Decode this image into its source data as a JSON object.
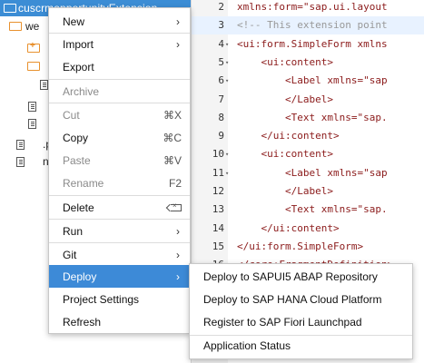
{
  "tree": {
    "project_label": "cuscrmopportunityExtension",
    "rows": [
      {
        "label": "we",
        "icon": "folder-icon"
      },
      {
        "label": "",
        "icon": "folder-plus-icon"
      },
      {
        "label": "",
        "icon": "folder-open-icon"
      },
      {
        "label": "",
        "icon": "file-icon"
      },
      {
        "label": "",
        "icon": "file-icon"
      },
      {
        "label": "",
        "icon": "file-icon"
      },
      {
        "label": ".p",
        "icon": "file-icon"
      },
      {
        "label": "ne",
        "icon": "file-icon"
      }
    ]
  },
  "editor": {
    "lines": [
      {
        "num": "2",
        "text": "xmlns:form=\"sap.ui.layout",
        "kind": "tag"
      },
      {
        "num": "3",
        "text": "<!-- This extension point",
        "kind": "comment"
      },
      {
        "num": "4",
        "text": "<ui:form.SimpleForm xmlns",
        "kind": "tag",
        "fold": true
      },
      {
        "num": "5",
        "text": "    <ui:content>",
        "kind": "tag",
        "fold": true
      },
      {
        "num": "6",
        "text": "        <Label xmlns=\"sap",
        "kind": "tag",
        "fold": true
      },
      {
        "num": "7",
        "text": "        </Label>",
        "kind": "tag"
      },
      {
        "num": "8",
        "text": "        <Text xmlns=\"sap.",
        "kind": "tag"
      },
      {
        "num": "9",
        "text": "    </ui:content>",
        "kind": "tag"
      },
      {
        "num": "10",
        "text": "    <ui:content>",
        "kind": "tag",
        "fold": true
      },
      {
        "num": "11",
        "text": "        <Label xmlns=\"sap",
        "kind": "tag",
        "fold": true
      },
      {
        "num": "12",
        "text": "        </Label>",
        "kind": "tag"
      },
      {
        "num": "13",
        "text": "        <Text xmlns=\"sap.",
        "kind": "tag"
      },
      {
        "num": "14",
        "text": "    </ui:content>",
        "kind": "tag"
      },
      {
        "num": "15",
        "text": "</ui:form.SimpleForm>",
        "kind": "tag"
      },
      {
        "num": "16",
        "text": "</core:FragmentDefinition>",
        "kind": "tag"
      }
    ]
  },
  "context_menu": {
    "items": {
      "new": {
        "label": "New",
        "arrow": "›"
      },
      "import": {
        "label": "Import",
        "arrow": "›"
      },
      "export": {
        "label": "Export"
      },
      "archive": {
        "label": "Archive"
      },
      "cut": {
        "label": "Cut",
        "shortcut": "⌘X"
      },
      "copy": {
        "label": "Copy",
        "shortcut": "⌘C"
      },
      "paste": {
        "label": "Paste",
        "shortcut": "⌘V"
      },
      "rename": {
        "label": "Rename",
        "shortcut": "F2"
      },
      "delete": {
        "label": "Delete"
      },
      "run": {
        "label": "Run",
        "arrow": "›"
      },
      "git": {
        "label": "Git",
        "arrow": "›"
      },
      "deploy": {
        "label": "Deploy",
        "arrow": "›"
      },
      "project_settings": {
        "label": "Project Settings"
      },
      "refresh": {
        "label": "Refresh"
      }
    }
  },
  "deploy_submenu": {
    "items": [
      "Deploy to SAPUI5 ABAP Repository",
      "Deploy to SAP HANA Cloud Platform",
      "Register to SAP Fiori Launchpad",
      "Application Status"
    ]
  },
  "colors": {
    "selection_blue": "#3c8dd5",
    "folder_orange": "#e8912e",
    "code_tag": "#800000",
    "code_comment": "#999999"
  }
}
